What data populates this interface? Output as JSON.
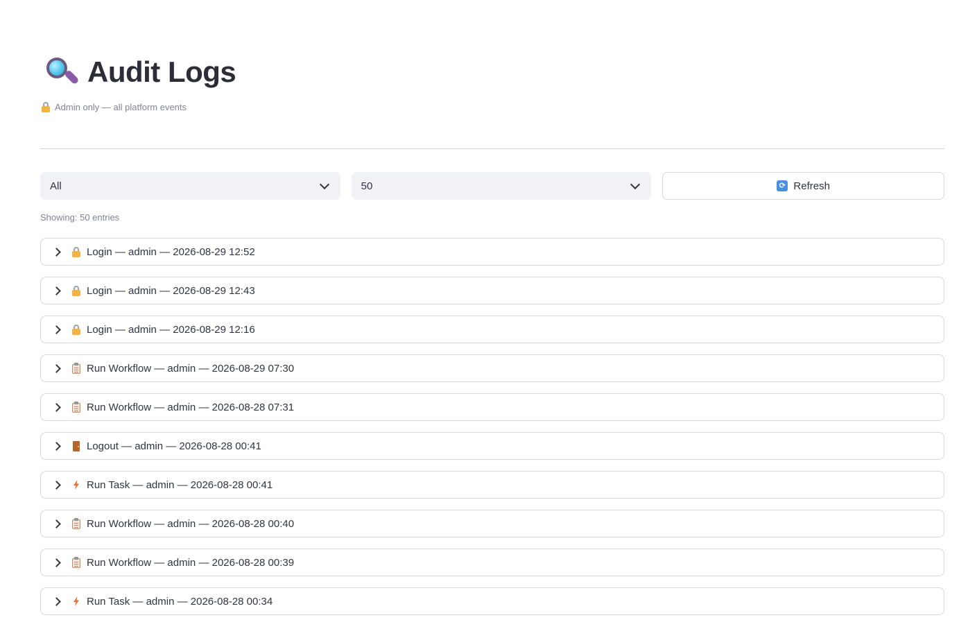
{
  "header": {
    "title": "Audit Logs",
    "title_icon": "magnifying-glass-icon",
    "caption": "Admin only — all platform events",
    "caption_icon": "lock-icon"
  },
  "filters": {
    "event_filter": {
      "value": "All"
    },
    "limit_filter": {
      "value": "50"
    },
    "refresh_button": {
      "label": "Refresh",
      "icon": "refresh-icon"
    }
  },
  "summary": {
    "showing_text": "Showing: 50 entries"
  },
  "logs": [
    {
      "icon": "lock",
      "text": "Login — admin — 2026-08-29 12:52"
    },
    {
      "icon": "lock",
      "text": "Login — admin — 2026-08-29 12:43"
    },
    {
      "icon": "lock",
      "text": "Login — admin — 2026-08-29 12:16"
    },
    {
      "icon": "clipboard",
      "text": "Run Workflow — admin — 2026-08-29 07:30"
    },
    {
      "icon": "clipboard",
      "text": "Run Workflow — admin — 2026-08-28 07:31"
    },
    {
      "icon": "door",
      "text": "Logout — admin — 2026-08-28 00:41"
    },
    {
      "icon": "bolt",
      "text": "Run Task — admin — 2026-08-28 00:41"
    },
    {
      "icon": "clipboard",
      "text": "Run Workflow — admin — 2026-08-28 00:40"
    },
    {
      "icon": "clipboard",
      "text": "Run Workflow — admin — 2026-08-28 00:39"
    },
    {
      "icon": "bolt",
      "text": "Run Task — admin — 2026-08-28 00:34"
    }
  ]
}
